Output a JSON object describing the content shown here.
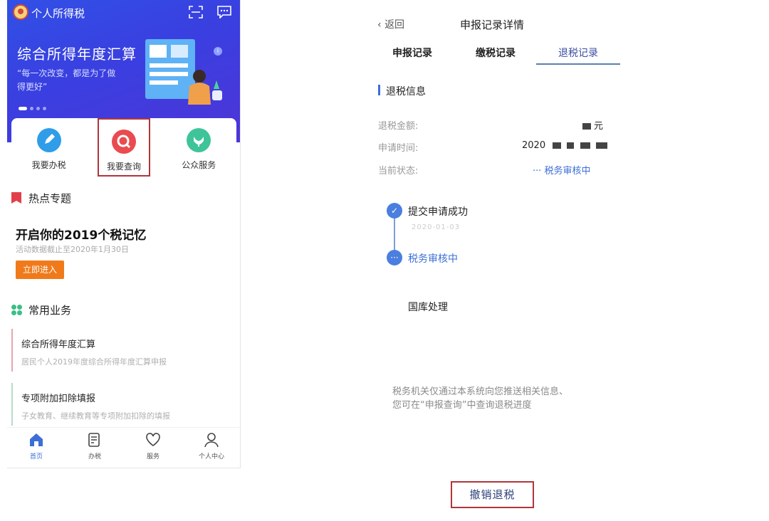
{
  "left": {
    "app_name": "个人所得税",
    "banner": {
      "title": "综合所得年度汇算",
      "subtitle": "“每一次改变，都是为了做得更好”",
      "dots": 4
    },
    "quick_actions": [
      {
        "label": "我要办税",
        "color": "#2f9de8"
      },
      {
        "label": "我要查询",
        "color": "#e94b4f"
      },
      {
        "label": "公众服务",
        "color": "#3fc49a"
      }
    ],
    "hot": {
      "heading": "热点专题",
      "title": "开启你的2019个税记忆",
      "desc": "活动数据截止至2020年1月30日",
      "button": "立即进入"
    },
    "common": {
      "heading": "常用业务",
      "items": [
        {
          "title": "综合所得年度汇算",
          "desc": "居民个人2019年度综合所得年度汇算申报"
        },
        {
          "title": "专项附加扣除填报",
          "desc": "子女教育、继续教育等专项附加扣除的填报"
        }
      ]
    },
    "nav": [
      "首页",
      "办税",
      "服务",
      "个人中心"
    ]
  },
  "right": {
    "back": "返回",
    "title": "申报记录详情",
    "tabs": [
      "申报记录",
      "缴税记录",
      "退税记录"
    ],
    "active_tab": "退税记录",
    "section_heading": "退税信息",
    "fields": {
      "amount_label": "退税金额:",
      "amount_suffix": "元",
      "time_label": "申请时间:",
      "time_value_prefix": "2020",
      "status_label": "当前状态:",
      "status_value": "··· 税务审核中"
    },
    "timeline": [
      {
        "label": "提交申请成功",
        "date": "2020-01-03"
      },
      {
        "label": "税务审核中"
      },
      {
        "label": "国库处理"
      }
    ],
    "notice_line1": "税务机关仅通过本系统向您推送相关信息、",
    "notice_line2": "您可在“申报查询”中查询退税进度",
    "cancel_button": "撤销退税",
    "colors": {
      "accent": "#3b6fd6",
      "highlight_border": "#b0353a"
    }
  }
}
